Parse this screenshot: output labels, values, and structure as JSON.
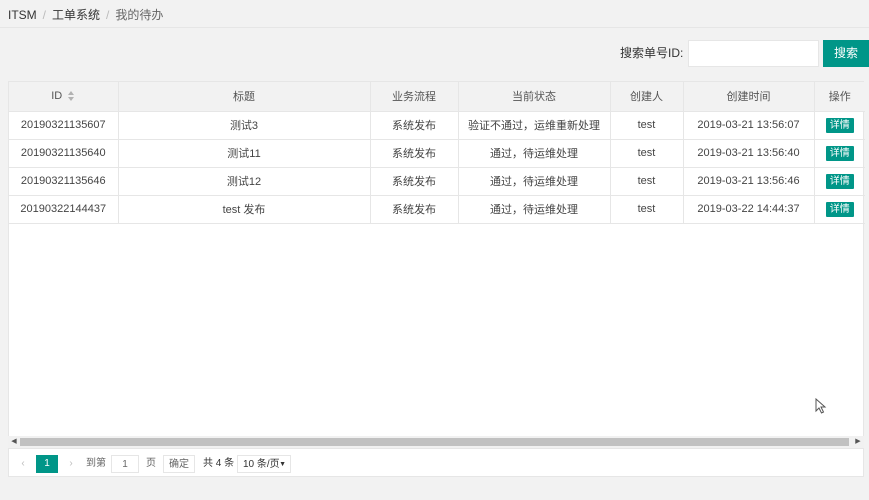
{
  "breadcrumb": {
    "items": [
      "ITSM",
      "工单系统",
      "我的待办"
    ],
    "separator": "/"
  },
  "search": {
    "label": "搜索单号ID:",
    "value": "",
    "placeholder": "",
    "button_label": "搜索"
  },
  "table": {
    "columns": [
      "ID",
      "标题",
      "业务流程",
      "当前状态",
      "创建人",
      "创建时间",
      "操作"
    ],
    "rows": [
      {
        "id": "20190321135607",
        "title": "测试3",
        "process": "系统发布",
        "status": "验证不通过，运维重新处理",
        "creator": "test",
        "created_at": "2019-03-21 13:56:07",
        "action": "详情"
      },
      {
        "id": "20190321135640",
        "title": "测试11",
        "process": "系统发布",
        "status": "通过，待运维处理",
        "creator": "test",
        "created_at": "2019-03-21 13:56:40",
        "action": "详情"
      },
      {
        "id": "20190321135646",
        "title": "测试12",
        "process": "系统发布",
        "status": "通过，待运维处理",
        "creator": "test",
        "created_at": "2019-03-21 13:56:46",
        "action": "详情"
      },
      {
        "id": "20190322144437",
        "title": "test 发布",
        "process": "系统发布",
        "status": "通过，待运维处理",
        "creator": "test",
        "created_at": "2019-03-22 14:44:37",
        "action": "详情"
      }
    ]
  },
  "pagination": {
    "prev": "‹",
    "current_page": "1",
    "next": "›",
    "goto_label": "到第",
    "goto_value": "1",
    "page_unit": "页",
    "confirm_label": "确定",
    "total_label": "共 4 条",
    "page_size": "10 条/页"
  },
  "colors": {
    "accent": "#009688"
  },
  "icons": {
    "sort": "sort-icon",
    "cursor": "mouse-cursor-icon"
  }
}
